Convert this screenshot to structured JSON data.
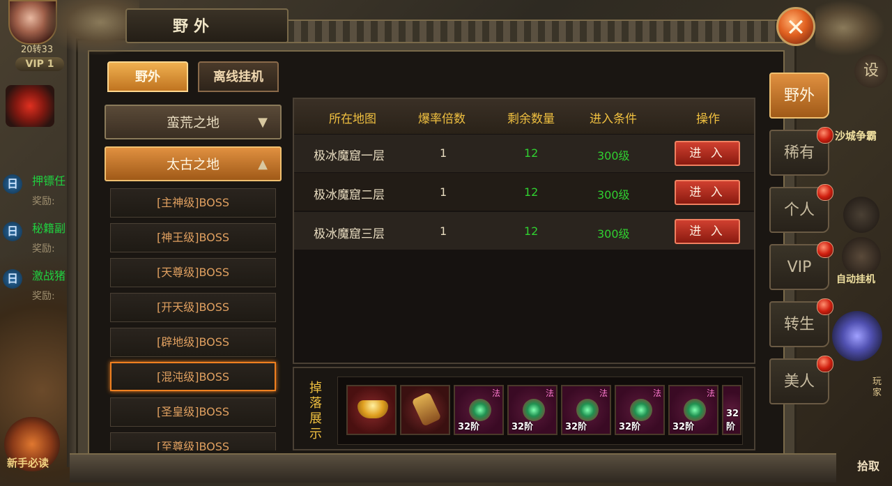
{
  "hud": {
    "level_text": "20转33",
    "vip_text": "VIP 1",
    "set_label": "设",
    "shacheng_label": "沙城争霸",
    "auto_label": "自动挂机",
    "pick_label": "拾取",
    "player_label": "玩家",
    "guide_label": "新手必读",
    "quests": [
      {
        "icon": "日",
        "title": "押镖任",
        "sub": "奖励:"
      },
      {
        "icon": "日",
        "title": "秘籍副",
        "sub": "奖励:"
      },
      {
        "icon": "日",
        "title": "激战猪",
        "sub": "奖励:"
      }
    ]
  },
  "panel": {
    "title": "野外",
    "close_label": "✕",
    "top_tabs": [
      {
        "label": "野外",
        "active": true
      },
      {
        "label": "离线挂机",
        "active": false
      }
    ],
    "categories": [
      {
        "label": "蛮荒之地",
        "expanded": false
      },
      {
        "label": "太古之地",
        "expanded": true
      }
    ],
    "boss_levels": [
      "[主神级]BOSS",
      "[神王级]BOSS",
      "[天尊级]BOSS",
      "[开天级]BOSS",
      "[辟地级]BOSS",
      "[混沌级]BOSS",
      "[圣皇级]BOSS",
      "[至尊级]BOSS"
    ],
    "selected_boss_index": 5,
    "table": {
      "headers": [
        "所在地图",
        "爆率倍数",
        "剩余数量",
        "进入条件",
        "操作"
      ],
      "rows": [
        {
          "map": "极冰魔窟一层",
          "rate": "1",
          "remaining": "12",
          "condition": "300级",
          "action": "进 入"
        },
        {
          "map": "极冰魔窟二层",
          "rate": "1",
          "remaining": "12",
          "condition": "300级",
          "action": "进 入"
        },
        {
          "map": "极冰魔窟三层",
          "rate": "1",
          "remaining": "12",
          "condition": "300级",
          "action": "进 入"
        }
      ]
    },
    "drop": {
      "label": "掉落展示",
      "items": [
        {
          "icon": "gold-ingot-icon",
          "tier": "",
          "class": ""
        },
        {
          "icon": "amulet-icon",
          "tier": "",
          "class": ""
        },
        {
          "icon": "helmet-icon",
          "tier": "32阶",
          "class": "法"
        },
        {
          "icon": "necklace-icon",
          "tier": "32阶",
          "class": "法"
        },
        {
          "icon": "bracelet-icon",
          "tier": "32阶",
          "class": "法"
        },
        {
          "icon": "ring-icon",
          "tier": "32阶",
          "class": "法"
        },
        {
          "icon": "belt-icon",
          "tier": "32阶",
          "class": "法"
        },
        {
          "icon": "boots-icon",
          "tier": "32阶",
          "class": ""
        }
      ]
    },
    "side_tabs": [
      {
        "label": "野外",
        "active": true,
        "dot": false
      },
      {
        "label": "稀有",
        "active": false,
        "dot": true
      },
      {
        "label": "个人",
        "active": false,
        "dot": true
      },
      {
        "label": "VIP",
        "active": false,
        "dot": true
      },
      {
        "label": "转生",
        "active": false,
        "dot": true
      },
      {
        "label": "美人",
        "active": false,
        "dot": true
      }
    ]
  },
  "colors": {
    "accent_orange": "#e09040",
    "header_gold": "#f0c040",
    "value_green": "#30d030",
    "enter_red": "#c03020"
  }
}
